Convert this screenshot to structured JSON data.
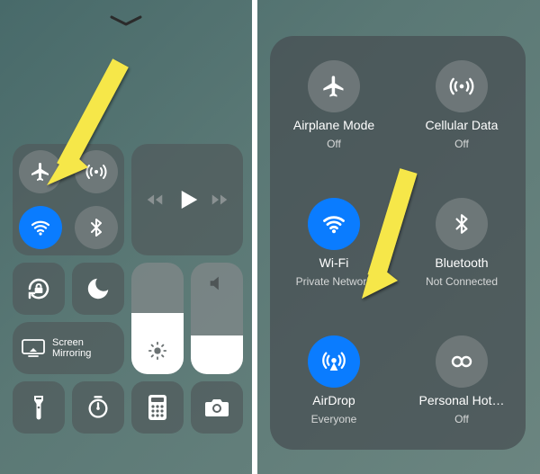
{
  "left": {
    "screen_mirroring_label": "Screen\nMirroring",
    "brightness_percent": 55,
    "volume_percent": 35
  },
  "right": {
    "cells": [
      {
        "label": "Airplane Mode",
        "status": "Off"
      },
      {
        "label": "Cellular Data",
        "status": "Off"
      },
      {
        "label": "Wi-Fi",
        "status": "Private Network"
      },
      {
        "label": "Bluetooth",
        "status": "Not Connected"
      },
      {
        "label": "AirDrop",
        "status": "Everyone"
      },
      {
        "label": "Personal Hot…",
        "status": "Off"
      }
    ]
  },
  "colors": {
    "accent": "#0a7cff",
    "arrow": "#f6e749"
  }
}
